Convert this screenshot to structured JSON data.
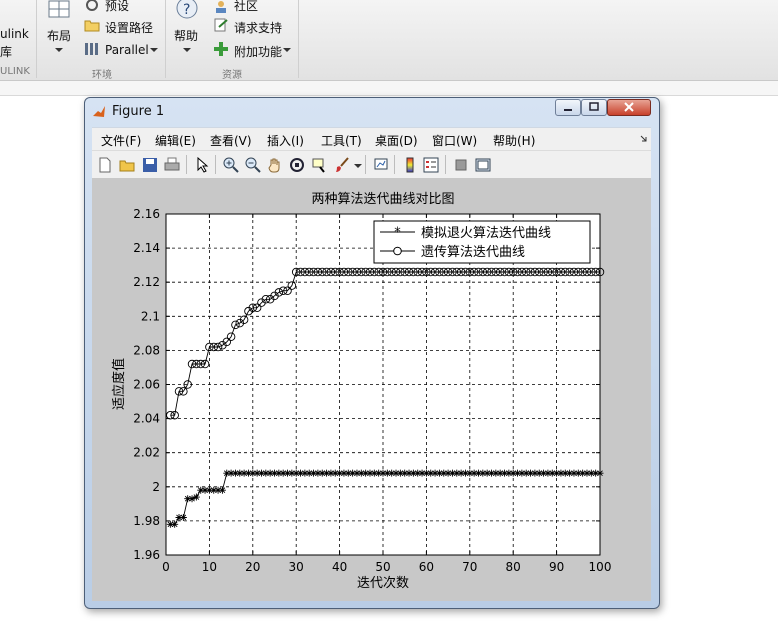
{
  "ribbon": {
    "simulink_label_1": "ulink",
    "simulink_label_2": "库",
    "simulink_section": "ULINK",
    "layout_label": "布局",
    "preferences_label": "预设",
    "set_path_label": "设置路径",
    "parallel_label": "Parallel",
    "env_section": "环境",
    "help_label": "帮助",
    "community_label": "社区",
    "request_support_label": "请求支持",
    "addons_label": "附加功能",
    "resources_section": "资源"
  },
  "window": {
    "title": "Figure 1",
    "menu": [
      "文件(F)",
      "编辑(E)",
      "查看(V)",
      "插入(I)",
      "工具(T)",
      "桌面(D)",
      "窗口(W)",
      "帮助(H)"
    ],
    "toolbar_icons": [
      "new-figure-icon",
      "open-file-icon",
      "save-icon",
      "print-icon",
      "pointer-icon",
      "zoom-in-icon",
      "zoom-out-icon",
      "pan-hand-icon",
      "rotate-3d-icon",
      "data-cursor-icon",
      "brush-icon",
      "link-plot-icon",
      "colorbar-icon",
      "legend-icon",
      "hide-plot-tools-icon",
      "show-plot-tools-icon"
    ]
  },
  "chart_data": {
    "type": "line",
    "title": "两种算法迭代曲线对比图",
    "xlabel": "迭代次数",
    "ylabel": "适应度值",
    "xlim": [
      0,
      100
    ],
    "ylim": [
      1.96,
      2.16
    ],
    "xticks": [
      "0",
      "10",
      "20",
      "30",
      "40",
      "50",
      "60",
      "70",
      "80",
      "90",
      "100"
    ],
    "yticks": [
      "1.96",
      "1.98",
      "2",
      "2.02",
      "2.04",
      "2.06",
      "2.08",
      "2.1",
      "2.12",
      "2.14",
      "2.16"
    ],
    "grid": true,
    "legend_position": "top-right",
    "series": [
      {
        "name": "模拟退火算法迭代曲线",
        "marker": "star",
        "x": [
          1,
          2,
          3,
          4,
          5,
          6,
          7,
          8,
          9,
          10,
          11,
          12,
          13,
          14,
          15,
          100
        ],
        "y": [
          1.978,
          1.978,
          1.982,
          1.982,
          1.993,
          1.993,
          1.994,
          1.998,
          1.998,
          1.998,
          1.998,
          1.998,
          1.998,
          2.008,
          2.008,
          2.008
        ]
      },
      {
        "name": "遗传算法迭代曲线",
        "marker": "circle",
        "x": [
          1,
          2,
          3,
          4,
          5,
          6,
          7,
          8,
          9,
          10,
          11,
          12,
          13,
          14,
          15,
          16,
          17,
          18,
          19,
          20,
          21,
          22,
          23,
          24,
          25,
          26,
          27,
          28,
          29,
          30,
          100
        ],
        "y": [
          2.042,
          2.042,
          2.056,
          2.056,
          2.06,
          2.072,
          2.072,
          2.072,
          2.072,
          2.082,
          2.082,
          2.082,
          2.083,
          2.085,
          2.088,
          2.095,
          2.096,
          2.098,
          2.103,
          2.105,
          2.105,
          2.108,
          2.11,
          2.11,
          2.112,
          2.114,
          2.115,
          2.115,
          2.118,
          2.126,
          2.126
        ]
      }
    ]
  }
}
